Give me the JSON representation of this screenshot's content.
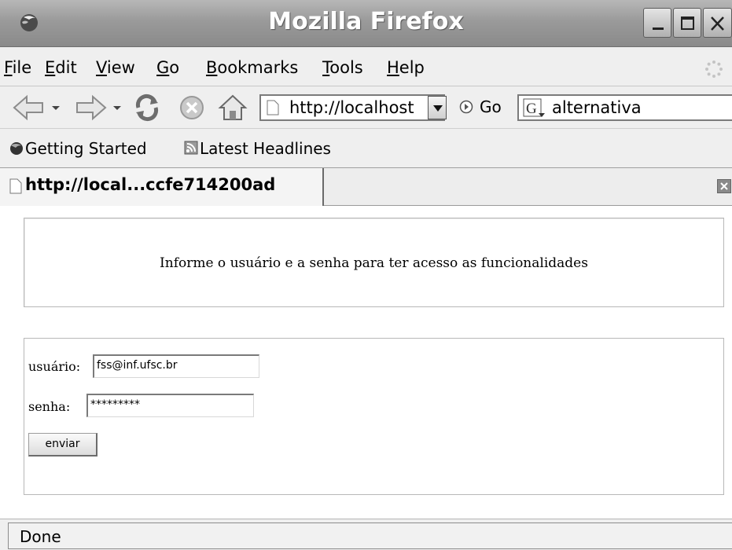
{
  "window": {
    "title": "Mozilla Firefox",
    "icon": "firefox-icon",
    "controls": [
      "minimize-icon",
      "maximize-icon",
      "close-icon"
    ]
  },
  "menubar": {
    "items": [
      {
        "mnemonic": "F",
        "rest": "ile"
      },
      {
        "mnemonic": "E",
        "rest": "dit"
      },
      {
        "mnemonic": "V",
        "rest": "iew"
      },
      {
        "mnemonic": "G",
        "rest": "o"
      },
      {
        "mnemonic": "B",
        "rest": "ookmarks"
      },
      {
        "mnemonic": "T",
        "rest": "ools"
      },
      {
        "mnemonic": "H",
        "rest": "elp"
      }
    ]
  },
  "navbar": {
    "url": "http://localhost",
    "go_label": "Go",
    "search_query": "alternativa"
  },
  "bookmarks": {
    "items": [
      "Getting Started",
      "Latest Headlines"
    ]
  },
  "tab": {
    "title": "http://local...ccfe714200ad"
  },
  "content": {
    "info_text": "Informe o usuário e a senha para ter acesso as funcionalidades",
    "form": {
      "user_label": "usuário:",
      "user_value": "fss@inf.ufsc.br",
      "password_label": "senha:",
      "password_value": "*********",
      "submit_label": "enviar"
    }
  },
  "status": {
    "text": "Done"
  }
}
